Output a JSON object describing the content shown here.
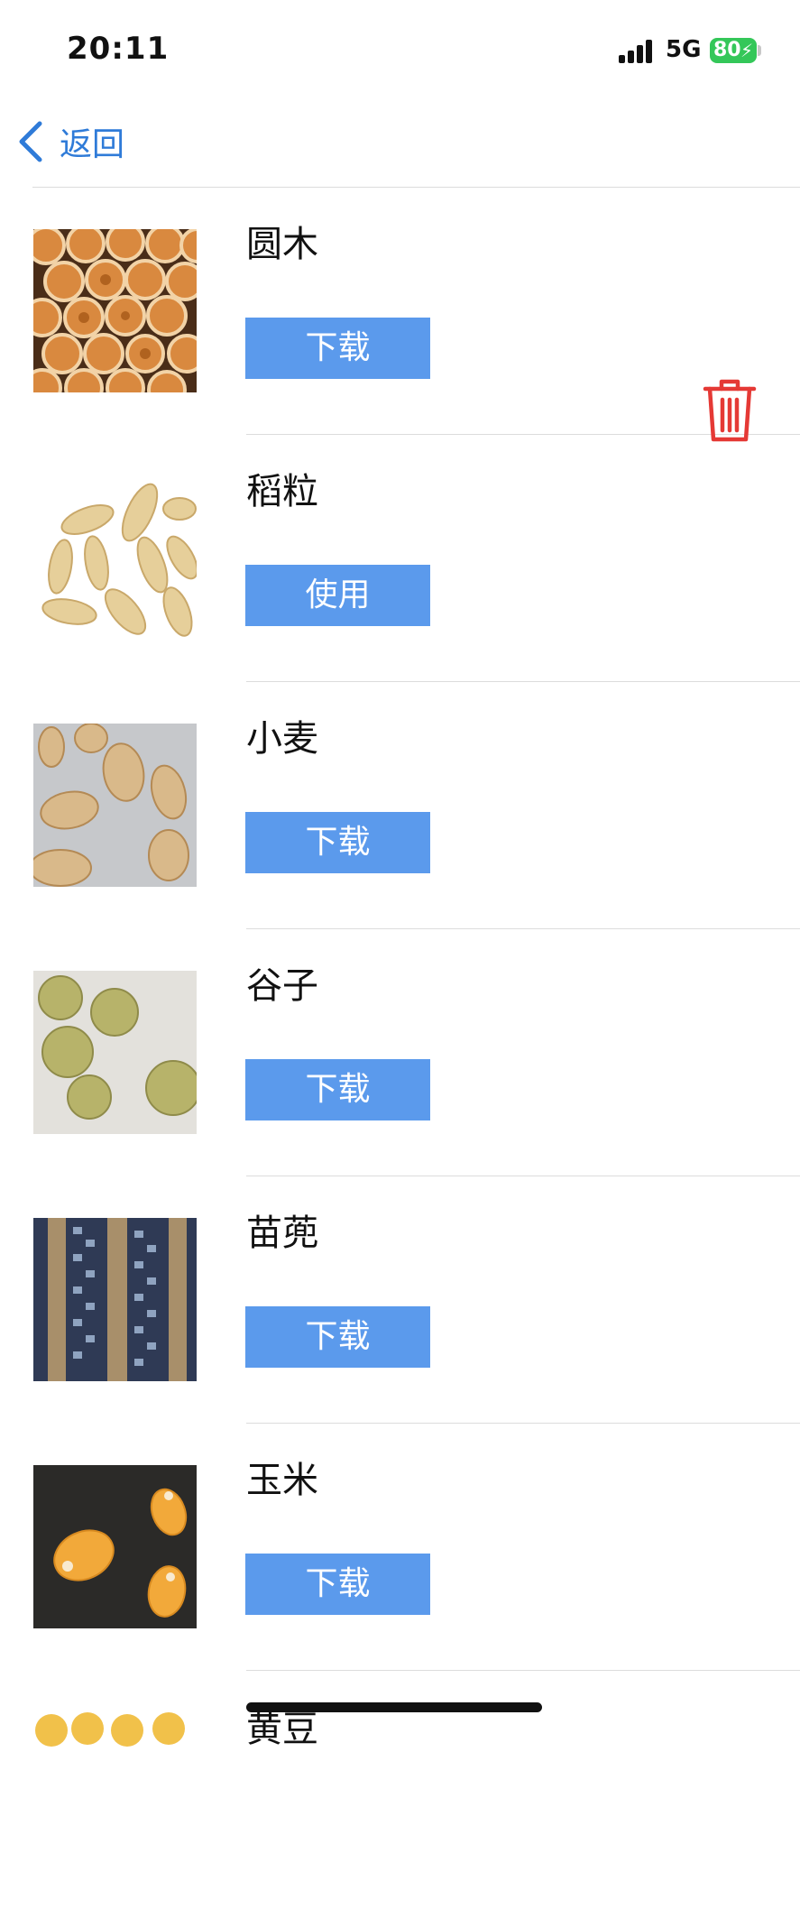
{
  "status_bar": {
    "time": "20:11",
    "network": "5G",
    "battery": "80"
  },
  "nav": {
    "back_label": "返回"
  },
  "items": [
    {
      "name": "圆木",
      "action": "下载",
      "thumb": "log-ends-thumbnail"
    },
    {
      "name": "稻粒",
      "action": "使用",
      "thumb": "rice-grain-thumbnail",
      "delete_icon": "trash-icon"
    },
    {
      "name": "小麦",
      "action": "下载",
      "thumb": "wheat-grain-thumbnail"
    },
    {
      "name": "谷子",
      "action": "下载",
      "thumb": "millet-thumbnail"
    },
    {
      "name": "苗蔸",
      "action": "下载",
      "thumb": "seedling-row-thumbnail"
    },
    {
      "name": "玉米",
      "action": "下载",
      "thumb": "corn-kernel-thumbnail"
    },
    {
      "name": "黄豆",
      "thumb": "soybean-thumbnail"
    }
  ],
  "colors": {
    "accent": "#2f7bd8",
    "button": "#5b9aec",
    "delete": "#e53935",
    "battery": "#34c759"
  }
}
